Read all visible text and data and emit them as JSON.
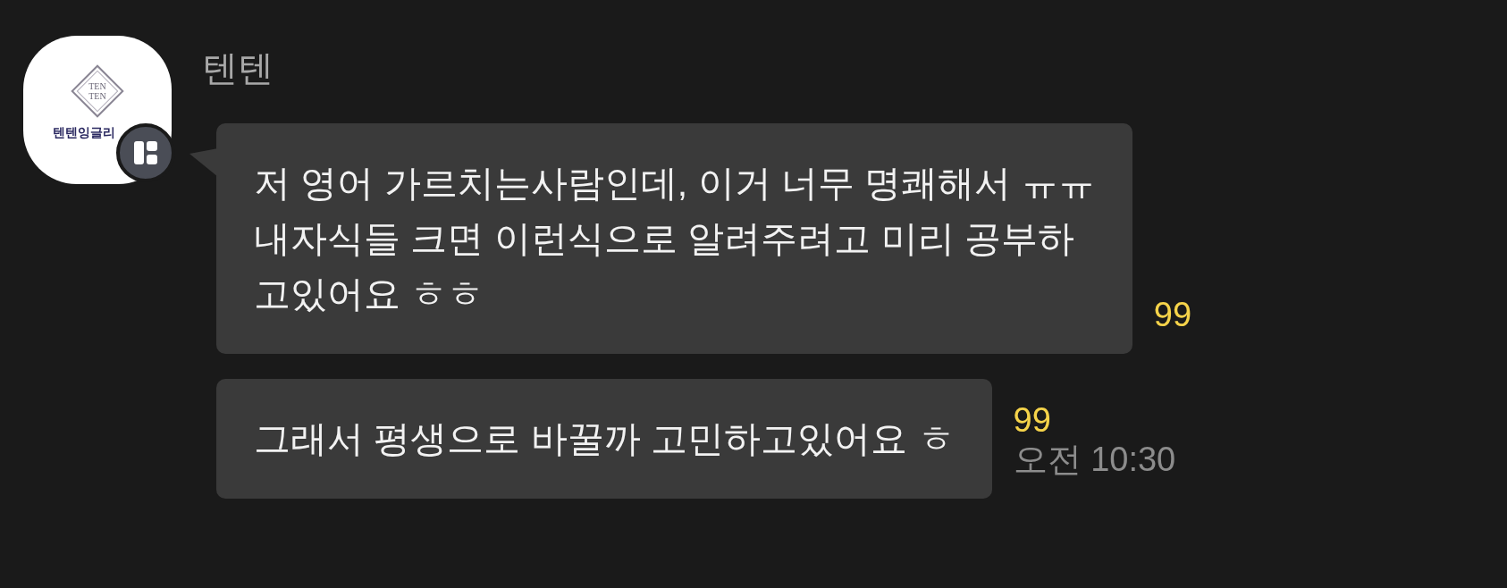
{
  "sender": {
    "name": "텐텐",
    "avatar": {
      "logo_lines": [
        "TEN",
        "TEN"
      ],
      "caption": "텐텐잉글리"
    }
  },
  "messages": [
    {
      "lines": [
        "저 영어 가르치는사람인데, 이거 너무 명쾌해서 ㅠㅠ",
        "내자식들 크면 이런식으로 알려주려고 미리 공부하",
        "고있어요 ㅎㅎ"
      ],
      "unread": "99"
    },
    {
      "lines": [
        "그래서 평생으로 바꿀까 고민하고있어요 ㅎ"
      ],
      "unread": "99",
      "time": "오전 10:30"
    }
  ]
}
